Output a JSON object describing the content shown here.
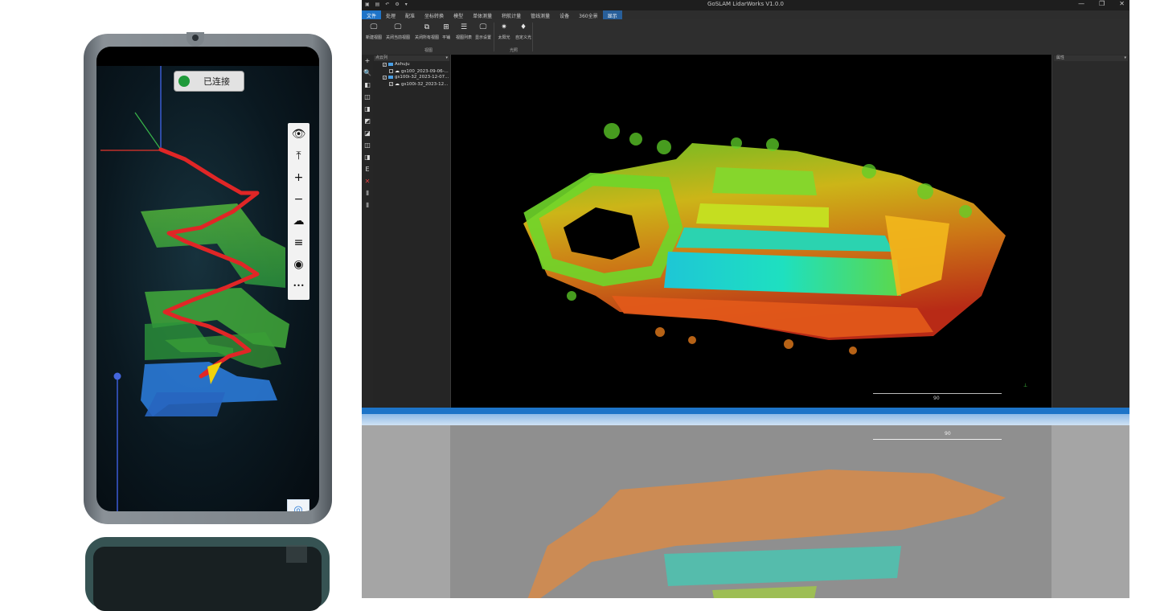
{
  "phone": {
    "connection_status": "已连接",
    "tools": [
      {
        "name": "eye-icon",
        "glyph": "👁"
      },
      {
        "name": "align-top-icon",
        "glyph": "⤒"
      },
      {
        "name": "zoom-in-icon",
        "glyph": "+"
      },
      {
        "name": "zoom-out-icon",
        "glyph": "−"
      },
      {
        "name": "cloud-icon",
        "glyph": "☁"
      },
      {
        "name": "menu-lines-icon",
        "glyph": "≡"
      },
      {
        "name": "target-settings-icon",
        "glyph": "◉"
      },
      {
        "name": "more-icon",
        "glyph": "•••"
      }
    ],
    "locate_icon": "◎"
  },
  "app": {
    "title": "GoSLAM LidarWorks V1.0.0",
    "window_controls": [
      "—",
      "❐",
      "✕"
    ],
    "quick_access": [
      "▣",
      "▤",
      "↶",
      "⚙",
      "▾"
    ],
    "menus": [
      "文件",
      "处理",
      "配准",
      "坐标转换",
      "模型",
      "单体测量",
      "积航计量",
      "管线测量",
      "设备",
      "360全景",
      "显示"
    ],
    "active_menu_index": 0,
    "selected_tab_index": 10,
    "ribbon": {
      "buttons": [
        {
          "label": "新建视图",
          "icon": "🖵"
        },
        {
          "label": "关闭当前视图",
          "icon": "🖵"
        },
        {
          "label": "关闭所有视图",
          "icon": "⧉"
        },
        {
          "label": "平铺",
          "icon": "⊞"
        },
        {
          "label": "视图列表",
          "icon": "☰"
        },
        {
          "label": "显示设置",
          "icon": "🖵"
        },
        {
          "label": "太阳光",
          "icon": "✷"
        },
        {
          "label": "自定义光",
          "icon": "♦"
        }
      ],
      "groups": [
        "视图",
        "光照"
      ]
    },
    "left_tools": [
      "+",
      "🔍",
      "◧",
      "◫",
      "◨",
      "◩",
      "◪",
      "◫",
      "◨",
      "E",
      "✕",
      "⫴",
      "⫴"
    ],
    "tree": {
      "combo": "点云列",
      "nodes": [
        {
          "label": "Ashuju",
          "type": "folder",
          "checked": true
        },
        {
          "label": "gs100_2023-09-06-...",
          "type": "cloud",
          "checked": false
        },
        {
          "label": "gs100i-32_2023-12-07...",
          "type": "folder",
          "checked": true
        },
        {
          "label": "gs100i-32_2023-12...",
          "type": "cloud",
          "checked": true
        }
      ]
    },
    "viewport": {
      "scale_label": "90"
    },
    "properties": {
      "combo": "属性"
    },
    "reflection_scale_label": "90"
  }
}
